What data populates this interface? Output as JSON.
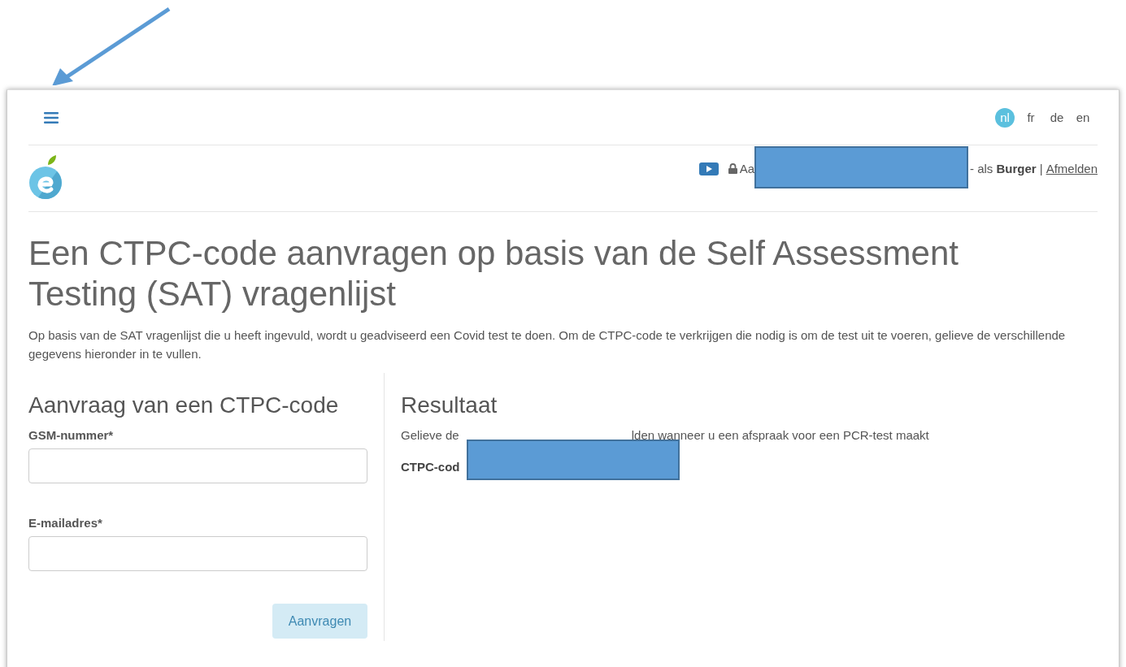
{
  "header": {
    "languages": [
      {
        "label": "nl",
        "selected": true
      },
      {
        "label": "fr",
        "selected": false
      },
      {
        "label": "de",
        "selected": false
      },
      {
        "label": "en",
        "selected": false
      }
    ],
    "user_bar": {
      "prefix": "Aa",
      "role_prefix": "- als",
      "role": "Burger",
      "separator": "|",
      "logout": "Afmelden"
    }
  },
  "page": {
    "title": "Een CTPC-code aanvragen op basis van de Self Assessment Testing (SAT) vragenlijst",
    "intro": "Op basis van de SAT vragenlijst die u heeft ingevuld, wordt u geadviseerd een Covid test te doen. Om de CTPC-code te verkrijgen die nodig is om de test uit te voeren, gelieve de verschillende gegevens hieronder in te vullen."
  },
  "form": {
    "title": "Aanvraag van een CTPC-code",
    "fields": [
      {
        "label": "GSM-nummer*"
      },
      {
        "label": "E-mailadres*"
      }
    ],
    "submit": {
      "label": "Aanvragen",
      "disabled": true
    }
  },
  "result": {
    "title": "Resultaat",
    "message_start": "Gelieve de",
    "message_end": "lden wanneer u een afspraak voor een PCR-test maakt",
    "code_label": "CTPC-cod"
  }
}
